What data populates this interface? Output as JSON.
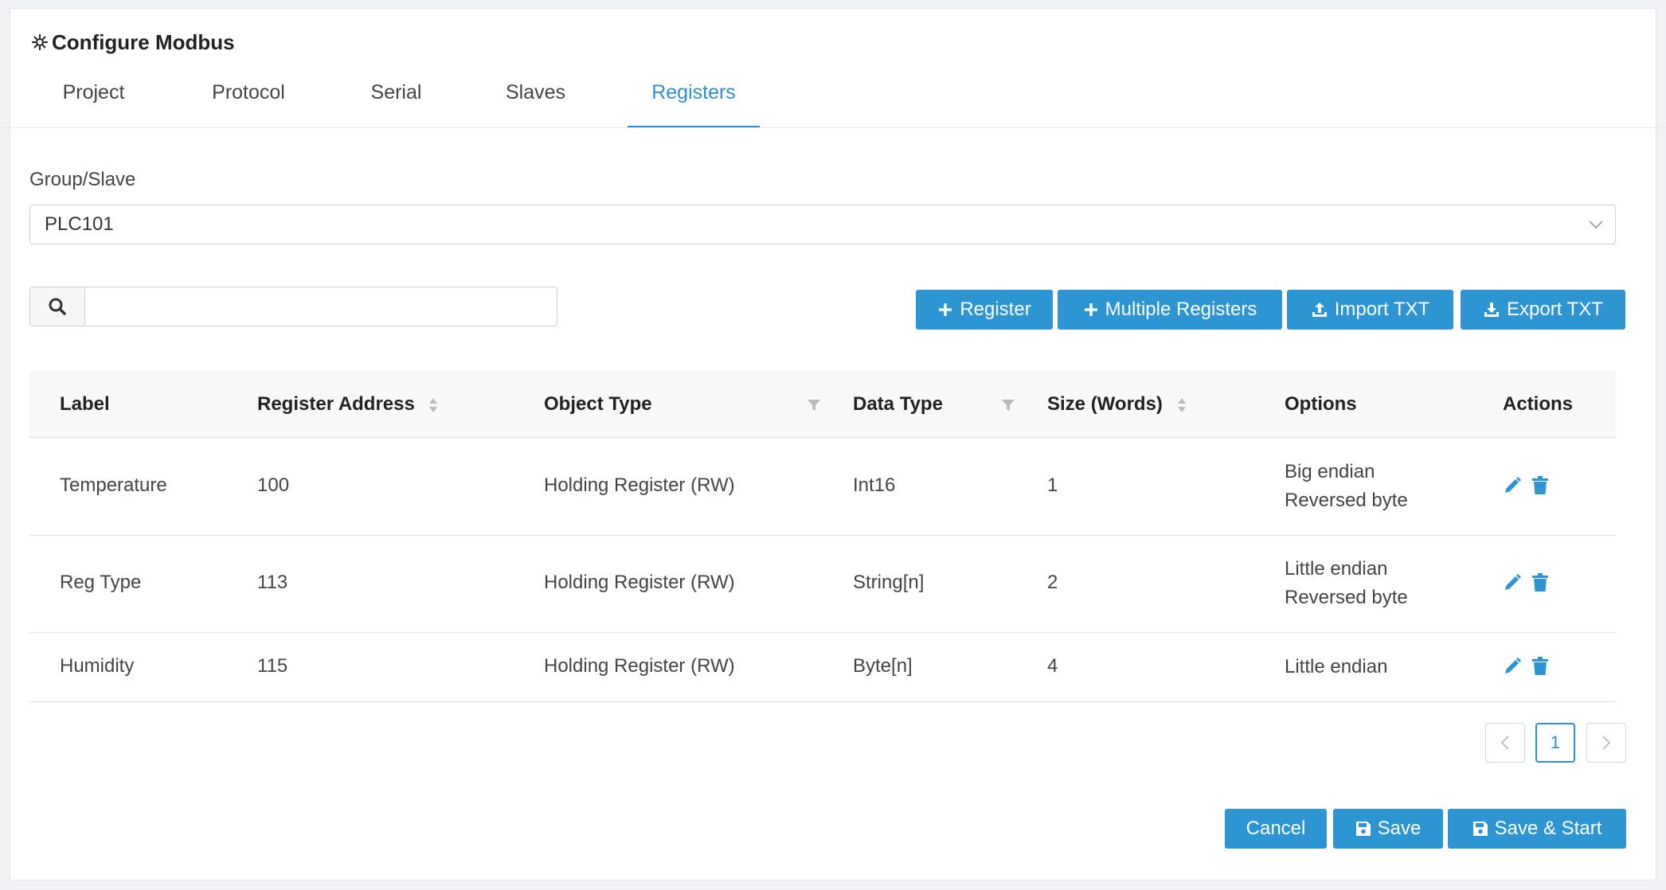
{
  "header": {
    "title": "Configure Modbus"
  },
  "tabs": [
    {
      "label": "Project"
    },
    {
      "label": "Protocol"
    },
    {
      "label": "Serial"
    },
    {
      "label": "Slaves"
    },
    {
      "label": "Registers",
      "active": true
    }
  ],
  "group": {
    "label": "Group/Slave",
    "selected": "PLC101"
  },
  "search": {
    "placeholder": "",
    "value": ""
  },
  "toolbar": {
    "add_register": "Register",
    "add_multiple": "Multiple Registers",
    "import": "Import TXT",
    "export": "Export TXT"
  },
  "table": {
    "columns": [
      "Label",
      "Register Address",
      "Object Type",
      "Data Type",
      "Size (Words)",
      "Options",
      "Actions"
    ],
    "rows": [
      {
        "label": "Temperature",
        "address": "100",
        "object_type": "Holding Register (RW)",
        "data_type": "Int16",
        "size": "1",
        "options": [
          "Big endian",
          "Reversed byte"
        ]
      },
      {
        "label": "Reg Type",
        "address": "113",
        "object_type": "Holding Register (RW)",
        "data_type": "String[n]",
        "size": "2",
        "options": [
          "Little endian",
          "Reversed byte"
        ]
      },
      {
        "label": "Humidity",
        "address": "115",
        "object_type": "Holding Register (RW)",
        "data_type": "Byte[n]",
        "size": "4",
        "options": [
          "Little endian"
        ]
      }
    ]
  },
  "pagination": {
    "current_page": "1"
  },
  "footer": {
    "cancel": "Cancel",
    "save": "Save",
    "save_start": "Save & Start"
  },
  "colors": {
    "accent": "#2e95d3",
    "active_tab": "#2e8fcf"
  },
  "icons": [
    "gear-icon",
    "search-icon",
    "plus-icon",
    "upload-icon",
    "download-icon",
    "edit-icon",
    "trash-icon",
    "floppy-icon",
    "chevron-down-icon",
    "chevron-left-icon",
    "chevron-right-icon",
    "sort-icon",
    "filter-icon"
  ]
}
